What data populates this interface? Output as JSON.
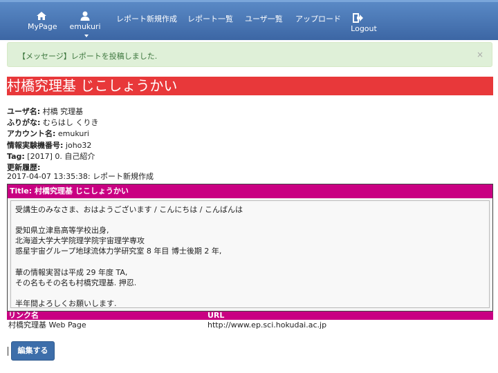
{
  "nav": {
    "mypage": "MyPage",
    "user": "emukuri",
    "report_new": "レポート新規作成",
    "report_list": "レポート一覧",
    "user_list": "ユーザ一覧",
    "upload": "アップロード",
    "logout": "Logout"
  },
  "alert": {
    "message": "【メッセージ】レポートを投稿しました.",
    "close": "×"
  },
  "page_title": "村橋究理基 じこしょうかい",
  "profile": {
    "username_label": "ユーザ名:",
    "username": "村橋 究理基",
    "kana_label": "ふりがな:",
    "kana": "むらはし くりき",
    "account_label": "アカウント名:",
    "account": "emukuri",
    "machine_label": "情報実験機番号:",
    "machine": "joho32",
    "tag_label": "Tag:",
    "tag": "[2017] 0. 自己紹介",
    "history_label": "更新履歴:",
    "history": "2017-04-07 13:35:38: レポート新規作成"
  },
  "report": {
    "title": "Title: 村橋究理基 じこしょうかい",
    "body": "受講生のみなさま、おはようございます / こんにちは / こんばんは\n\n愛知県立津島高等学校出身,\n北海道大学大学院理学院宇宙理学専攻\n惑星宇宙グループ地球流体力学研究室 8 年目 博士後期 2 年,\n\n華の情報実習は平成 29 年度 TA,\nその名もその名も村橋究理基. 押忍.\n\n半年間よろしくお願いします."
  },
  "links": {
    "col_name": "リンク名",
    "col_url": "URL",
    "rows": [
      {
        "name": "村橋究理基 Web Page",
        "url": "http://www.ep.sci.hokudai.ac.jp"
      }
    ]
  },
  "edit_button": "編集する"
}
